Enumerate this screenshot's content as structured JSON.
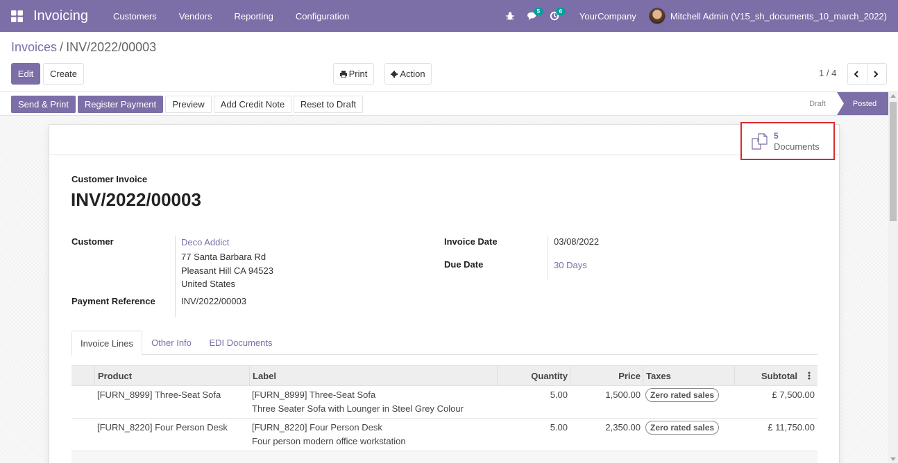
{
  "navbar": {
    "app_title": "Invoicing",
    "menu": [
      "Customers",
      "Vendors",
      "Reporting",
      "Configuration"
    ],
    "messages_count": "5",
    "activities_count": "6",
    "company": "YourCompany",
    "user": "Mitchell Admin (V15_sh_documents_10_march_2022)",
    "brand_color": "#7c6ea7"
  },
  "breadcrumb": {
    "parent": "Invoices",
    "separator": "/",
    "current": "INV/2022/00003"
  },
  "control": {
    "edit": "Edit",
    "create": "Create",
    "print": "Print",
    "action": "Action",
    "pager": "1 / 4"
  },
  "statusbar": {
    "buttons": [
      "Send & Print",
      "Register Payment",
      "Preview",
      "Add Credit Note",
      "Reset to Draft"
    ],
    "stages": {
      "draft": "Draft",
      "posted": "Posted"
    }
  },
  "smart_button": {
    "count": "5",
    "label": "Documents"
  },
  "invoice": {
    "type": "Customer Invoice",
    "name": "INV/2022/00003",
    "customer_label": "Customer",
    "customer_name": "Deco Addict",
    "address": [
      "77 Santa Barbara Rd",
      "Pleasant Hill CA 94523",
      "United States"
    ],
    "payment_ref_label": "Payment Reference",
    "payment_ref": "INV/2022/00003",
    "invoice_date_label": "Invoice Date",
    "invoice_date": "03/08/2022",
    "due_date_label": "Due Date",
    "due_date": "30 Days"
  },
  "tabs": [
    "Invoice Lines",
    "Other Info",
    "EDI Documents"
  ],
  "lines": {
    "headers": {
      "product": "Product",
      "label": "Label",
      "quantity": "Quantity",
      "price": "Price",
      "taxes": "Taxes",
      "subtotal": "Subtotal"
    },
    "rows": [
      {
        "product": "[FURN_8999] Three-Seat Sofa",
        "label1": "[FURN_8999] Three-Seat Sofa",
        "label2": "Three Seater Sofa with Lounger in Steel Grey Colour",
        "quantity": "5.00",
        "price": "1,500.00",
        "tax": "Zero rated sales",
        "subtotal": "£ 7,500.00"
      },
      {
        "product": "[FURN_8220] Four Person Desk",
        "label1": "[FURN_8220] Four Person Desk",
        "label2": "Four person modern office workstation",
        "quantity": "5.00",
        "price": "2,350.00",
        "tax": "Zero rated sales",
        "subtotal": "£ 11,750.00"
      }
    ]
  }
}
